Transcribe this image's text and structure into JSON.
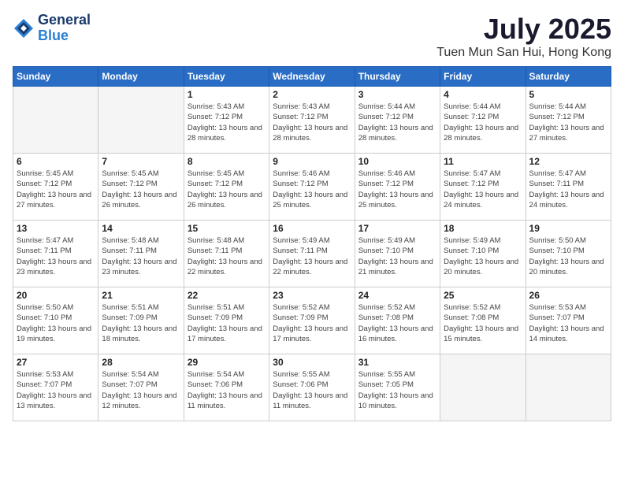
{
  "header": {
    "logo_line1": "General",
    "logo_line2": "Blue",
    "month": "July 2025",
    "location": "Tuen Mun San Hui, Hong Kong"
  },
  "weekdays": [
    "Sunday",
    "Monday",
    "Tuesday",
    "Wednesday",
    "Thursday",
    "Friday",
    "Saturday"
  ],
  "weeks": [
    [
      {
        "day": "",
        "info": ""
      },
      {
        "day": "",
        "info": ""
      },
      {
        "day": "1",
        "info": "Sunrise: 5:43 AM\nSunset: 7:12 PM\nDaylight: 13 hours\nand 28 minutes."
      },
      {
        "day": "2",
        "info": "Sunrise: 5:43 AM\nSunset: 7:12 PM\nDaylight: 13 hours\nand 28 minutes."
      },
      {
        "day": "3",
        "info": "Sunrise: 5:44 AM\nSunset: 7:12 PM\nDaylight: 13 hours\nand 28 minutes."
      },
      {
        "day": "4",
        "info": "Sunrise: 5:44 AM\nSunset: 7:12 PM\nDaylight: 13 hours\nand 28 minutes."
      },
      {
        "day": "5",
        "info": "Sunrise: 5:44 AM\nSunset: 7:12 PM\nDaylight: 13 hours\nand 27 minutes."
      }
    ],
    [
      {
        "day": "6",
        "info": "Sunrise: 5:45 AM\nSunset: 7:12 PM\nDaylight: 13 hours\nand 27 minutes."
      },
      {
        "day": "7",
        "info": "Sunrise: 5:45 AM\nSunset: 7:12 PM\nDaylight: 13 hours\nand 26 minutes."
      },
      {
        "day": "8",
        "info": "Sunrise: 5:45 AM\nSunset: 7:12 PM\nDaylight: 13 hours\nand 26 minutes."
      },
      {
        "day": "9",
        "info": "Sunrise: 5:46 AM\nSunset: 7:12 PM\nDaylight: 13 hours\nand 25 minutes."
      },
      {
        "day": "10",
        "info": "Sunrise: 5:46 AM\nSunset: 7:12 PM\nDaylight: 13 hours\nand 25 minutes."
      },
      {
        "day": "11",
        "info": "Sunrise: 5:47 AM\nSunset: 7:12 PM\nDaylight: 13 hours\nand 24 minutes."
      },
      {
        "day": "12",
        "info": "Sunrise: 5:47 AM\nSunset: 7:11 PM\nDaylight: 13 hours\nand 24 minutes."
      }
    ],
    [
      {
        "day": "13",
        "info": "Sunrise: 5:47 AM\nSunset: 7:11 PM\nDaylight: 13 hours\nand 23 minutes."
      },
      {
        "day": "14",
        "info": "Sunrise: 5:48 AM\nSunset: 7:11 PM\nDaylight: 13 hours\nand 23 minutes."
      },
      {
        "day": "15",
        "info": "Sunrise: 5:48 AM\nSunset: 7:11 PM\nDaylight: 13 hours\nand 22 minutes."
      },
      {
        "day": "16",
        "info": "Sunrise: 5:49 AM\nSunset: 7:11 PM\nDaylight: 13 hours\nand 22 minutes."
      },
      {
        "day": "17",
        "info": "Sunrise: 5:49 AM\nSunset: 7:10 PM\nDaylight: 13 hours\nand 21 minutes."
      },
      {
        "day": "18",
        "info": "Sunrise: 5:49 AM\nSunset: 7:10 PM\nDaylight: 13 hours\nand 20 minutes."
      },
      {
        "day": "19",
        "info": "Sunrise: 5:50 AM\nSunset: 7:10 PM\nDaylight: 13 hours\nand 20 minutes."
      }
    ],
    [
      {
        "day": "20",
        "info": "Sunrise: 5:50 AM\nSunset: 7:10 PM\nDaylight: 13 hours\nand 19 minutes."
      },
      {
        "day": "21",
        "info": "Sunrise: 5:51 AM\nSunset: 7:09 PM\nDaylight: 13 hours\nand 18 minutes."
      },
      {
        "day": "22",
        "info": "Sunrise: 5:51 AM\nSunset: 7:09 PM\nDaylight: 13 hours\nand 17 minutes."
      },
      {
        "day": "23",
        "info": "Sunrise: 5:52 AM\nSunset: 7:09 PM\nDaylight: 13 hours\nand 17 minutes."
      },
      {
        "day": "24",
        "info": "Sunrise: 5:52 AM\nSunset: 7:08 PM\nDaylight: 13 hours\nand 16 minutes."
      },
      {
        "day": "25",
        "info": "Sunrise: 5:52 AM\nSunset: 7:08 PM\nDaylight: 13 hours\nand 15 minutes."
      },
      {
        "day": "26",
        "info": "Sunrise: 5:53 AM\nSunset: 7:07 PM\nDaylight: 13 hours\nand 14 minutes."
      }
    ],
    [
      {
        "day": "27",
        "info": "Sunrise: 5:53 AM\nSunset: 7:07 PM\nDaylight: 13 hours\nand 13 minutes."
      },
      {
        "day": "28",
        "info": "Sunrise: 5:54 AM\nSunset: 7:07 PM\nDaylight: 13 hours\nand 12 minutes."
      },
      {
        "day": "29",
        "info": "Sunrise: 5:54 AM\nSunset: 7:06 PM\nDaylight: 13 hours\nand 11 minutes."
      },
      {
        "day": "30",
        "info": "Sunrise: 5:55 AM\nSunset: 7:06 PM\nDaylight: 13 hours\nand 11 minutes."
      },
      {
        "day": "31",
        "info": "Sunrise: 5:55 AM\nSunset: 7:05 PM\nDaylight: 13 hours\nand 10 minutes."
      },
      {
        "day": "",
        "info": ""
      },
      {
        "day": "",
        "info": ""
      }
    ]
  ]
}
